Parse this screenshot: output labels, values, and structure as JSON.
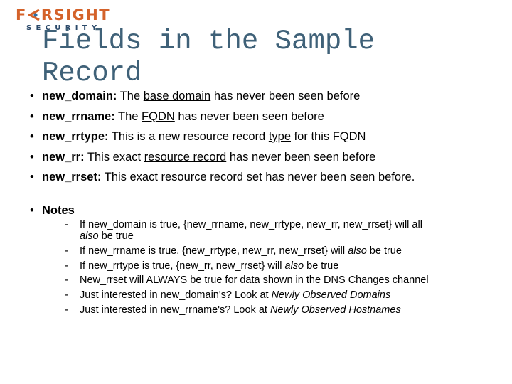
{
  "logo": {
    "brand": "FARSIGHT",
    "brand_prefix": "F",
    "brand_suffix": "RSIGHT",
    "sub": "SECURITY",
    "eye_icon": "eye-chevron-icon",
    "colors": {
      "brand": "#d4622a",
      "sub": "#2c4a6a",
      "eye_dot": "#2d6ea6"
    }
  },
  "title": "Fields in the Sample Record",
  "title_color": "#3f6178",
  "fields": [
    {
      "name": "new_domain:",
      "pre": " The ",
      "underlined": "base domain",
      "post": " has never been seen before"
    },
    {
      "name": "new_rrname:",
      "pre": " The ",
      "underlined": "FQDN",
      "post": " has never been seen before"
    },
    {
      "name": "new_rrtype:",
      "pre": " This is a new resource record ",
      "underlined": "type",
      "post": " for this FQDN"
    },
    {
      "name": "new_rr:",
      "pre": " This exact ",
      "underlined": "resource record",
      "post": " has never been seen before"
    },
    {
      "name": "new_rrset:",
      "pre": " This exact resource record set has never been seen before.",
      "underlined": "",
      "post": ""
    }
  ],
  "notes": {
    "label": "Notes",
    "items": [
      {
        "text": "If new_domain is true, {new_rrname, new_rrtype, new_rr, new_rrset} will all ",
        "italic": "also",
        "after": " be true",
        "wrap": true
      },
      {
        "text": "If new_rrname is true, {new_rrtype, new_rr, new_rrset} will ",
        "italic": "also",
        "after": " be true"
      },
      {
        "text": "If new_rrtype is true, {new_rr, new_rrset} will ",
        "italic": "also",
        "after": " be true"
      },
      {
        "text": "New_rrset will ALWAYS be true for data shown in the DNS Changes channel",
        "italic": "",
        "after": ""
      },
      {
        "text": "Just interested in new_domain's? Look at ",
        "italic": "Newly Observed Domains",
        "after": ""
      },
      {
        "text": "Just interested in new_rrname's? Look at ",
        "italic": "Newly Observed Hostnames",
        "after": ""
      }
    ]
  },
  "bullet_char": "•",
  "dash_char": "-"
}
